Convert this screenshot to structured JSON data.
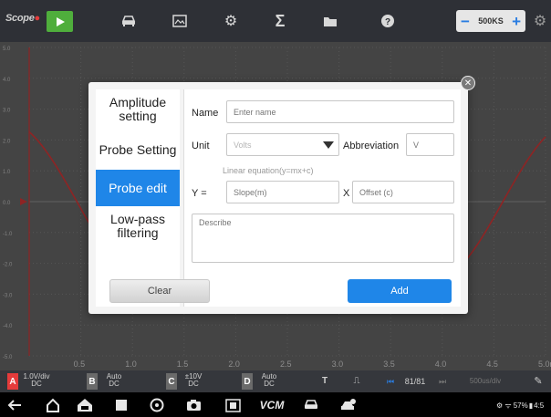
{
  "toolbar": {
    "logo_text": "Scope",
    "sample_rate": "500KS",
    "icons": [
      "play-icon",
      "car-icon",
      "image-icon",
      "gear-icon",
      "sigma-icon",
      "folder-icon",
      "help-icon",
      "settings-icon"
    ]
  },
  "scope": {
    "y_ticks": [
      "5.0",
      "4.0",
      "3.0",
      "2.0",
      "1.0",
      "0.0",
      "-1.0",
      "-2.0",
      "-3.0",
      "-4.0",
      "-5.0"
    ],
    "x_ticks": [
      "0.5",
      "1.0",
      "1.5",
      "2.0",
      "2.5",
      "3.0",
      "3.5",
      "4.0",
      "4.5",
      "5.0m"
    ]
  },
  "channels": [
    {
      "letter": "A",
      "line1": "1.0V/div",
      "line2": "DC",
      "color": "#e53b3b"
    },
    {
      "letter": "B",
      "line1": "Auto",
      "line2": "DC",
      "color": "#6a6a6a"
    },
    {
      "letter": "C",
      "line1": "±10V",
      "line2": "DC",
      "color": "#6a6a6a"
    },
    {
      "letter": "D",
      "line1": "Auto",
      "line2": "DC",
      "color": "#6a6a6a"
    }
  ],
  "bottom_controls": {
    "trigger_label": "T",
    "page_counter": "81/81",
    "timebase": "500us/div"
  },
  "status_bar": {
    "battery": "57%",
    "time": "4:5"
  },
  "dialog": {
    "tabs": [
      {
        "label": "Amplitude setting",
        "active": false
      },
      {
        "label": "Probe Setting",
        "active": false
      },
      {
        "label": "Probe edit",
        "active": true
      },
      {
        "label": "Low-pass filtering",
        "active": false
      }
    ],
    "name_label": "Name",
    "name_placeholder": "Enter name",
    "unit_label": "Unit",
    "unit_value": "Volts",
    "abbrev_label": "Abbreviation",
    "abbrev_value": "V",
    "equation_hint": "Linear equation(y=mx+c)",
    "y_label": "Y =",
    "slope_placeholder": "Slope(m)",
    "x_label": "X +",
    "offset_placeholder": "Offset (c)",
    "describe_placeholder": "Describe",
    "clear_label": "Clear",
    "add_label": "Add"
  }
}
